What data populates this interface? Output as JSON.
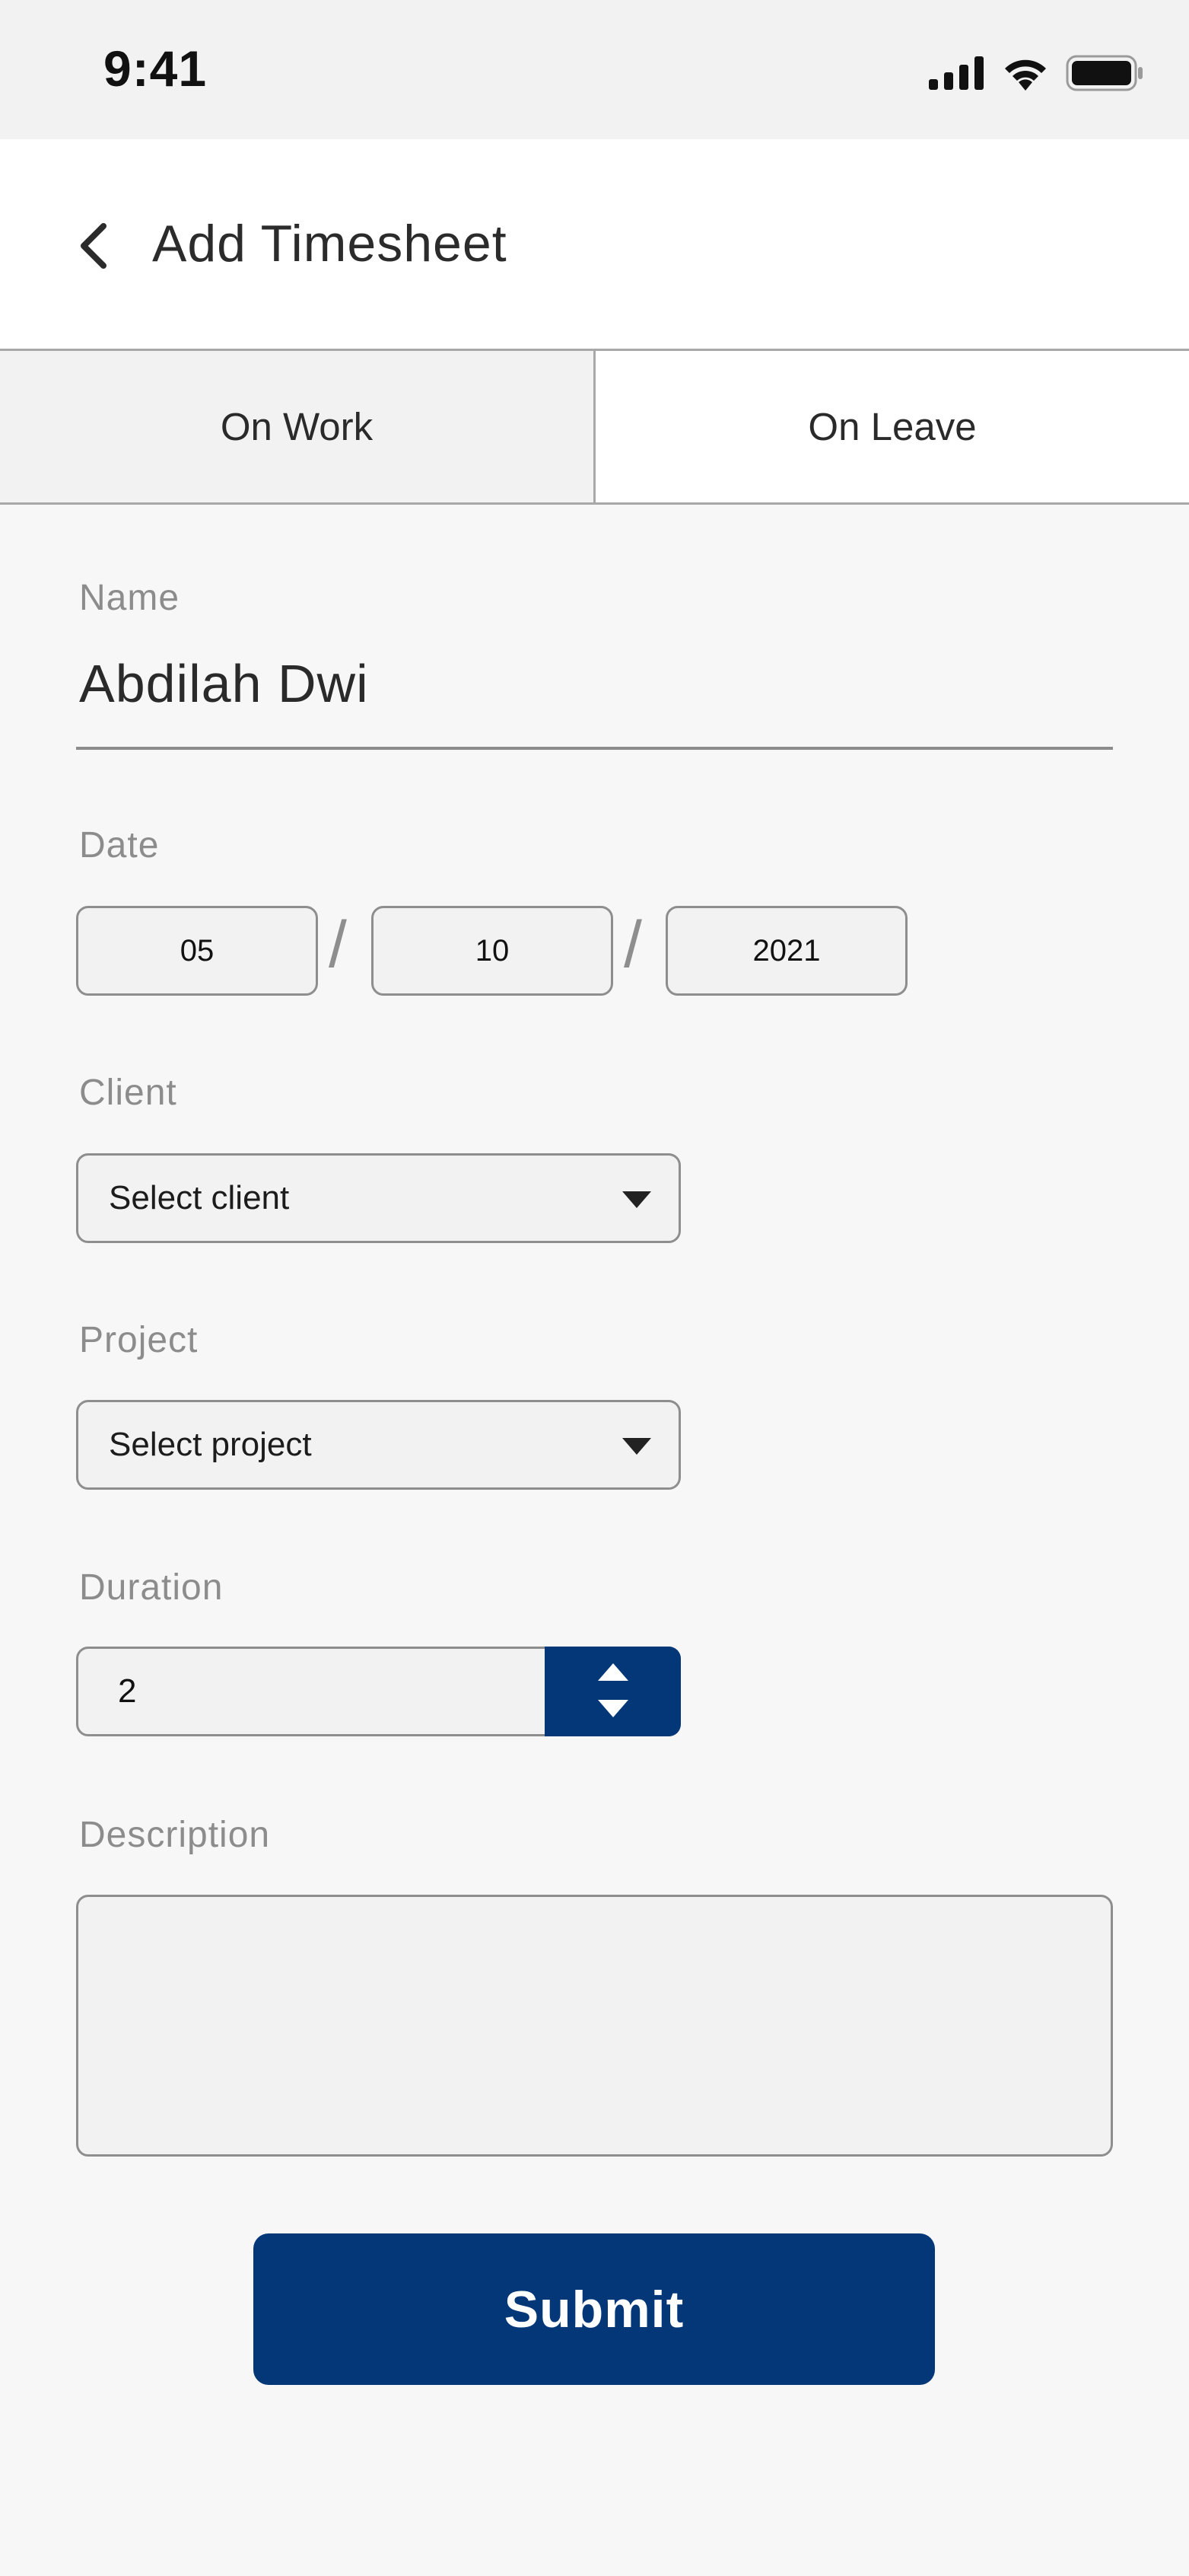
{
  "status_bar": {
    "time": "9:41"
  },
  "header": {
    "title": "Add Timesheet"
  },
  "tabs": [
    {
      "label": "On Work",
      "selected": false
    },
    {
      "label": "On Leave",
      "selected": true
    }
  ],
  "form": {
    "name": {
      "label": "Name",
      "value": "Abdilah Dwi"
    },
    "date": {
      "label": "Date",
      "day": "05",
      "month": "10",
      "year": "2021",
      "separator": "/"
    },
    "client": {
      "label": "Client",
      "value": "Select client"
    },
    "project": {
      "label": "Project",
      "value": "Select project"
    },
    "duration": {
      "label": "Duration",
      "value": "2"
    },
    "description": {
      "label": "Description",
      "value": ""
    }
  },
  "submit_label": "Submit",
  "colors": {
    "primary": "#043778",
    "label_gray": "#8c8c8c",
    "field_bg": "#f2f2f2",
    "page_bg": "#f7f7f7"
  },
  "icons": [
    "back-chevron-icon",
    "cellular-signal-icon",
    "wifi-icon",
    "battery-icon",
    "dropdown-caret-icon",
    "stepper-up-icon",
    "stepper-down-icon"
  ]
}
